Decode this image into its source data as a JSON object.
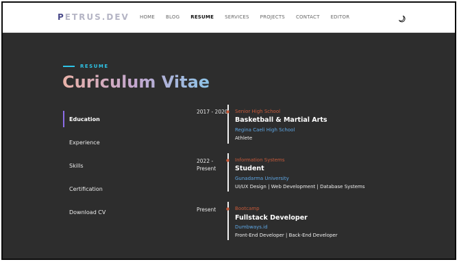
{
  "brand": {
    "logo_first": "P",
    "logo_rest": "ETRUS.DEV"
  },
  "nav": {
    "items": [
      "HOME",
      "BLOG",
      "RESUME",
      "SERVICES",
      "PROJECTS",
      "CONTACT",
      "EDITOR"
    ],
    "active": "RESUME"
  },
  "header": {
    "section_label": "RESUME",
    "title": "Curiculum Vitae"
  },
  "sidebar": {
    "items": [
      {
        "label": "Education"
      },
      {
        "label": "Experience"
      },
      {
        "label": "Skills"
      },
      {
        "label": "Certification"
      },
      {
        "label": "Download CV"
      }
    ],
    "active": "Education"
  },
  "timeline": [
    {
      "date": "2017 - 2020",
      "type": "Senior High School",
      "title": "Basketball & Martial Arts",
      "org": "Regina Caeli High School",
      "desc": "Athlete"
    },
    {
      "date_line1": "2022 -",
      "date_line2": "Present",
      "type": "Information Systems",
      "title": "Student",
      "org": "Gunadarma University",
      "desc": "UI/UX Design | Web Development | Database Systems"
    },
    {
      "date": "Present",
      "type": "Bootcamp",
      "title": "Fullstack Developer",
      "org": "Dumbways.id",
      "desc": "Front-End Developer | Back-End Developer"
    }
  ],
  "colors": {
    "background": "#2d2d2d",
    "accent_cyan": "#2ec5e8",
    "timeline_type": "#c95a3a",
    "timeline_org": "#5fa8e6",
    "active_marker": "#8c6de8"
  }
}
